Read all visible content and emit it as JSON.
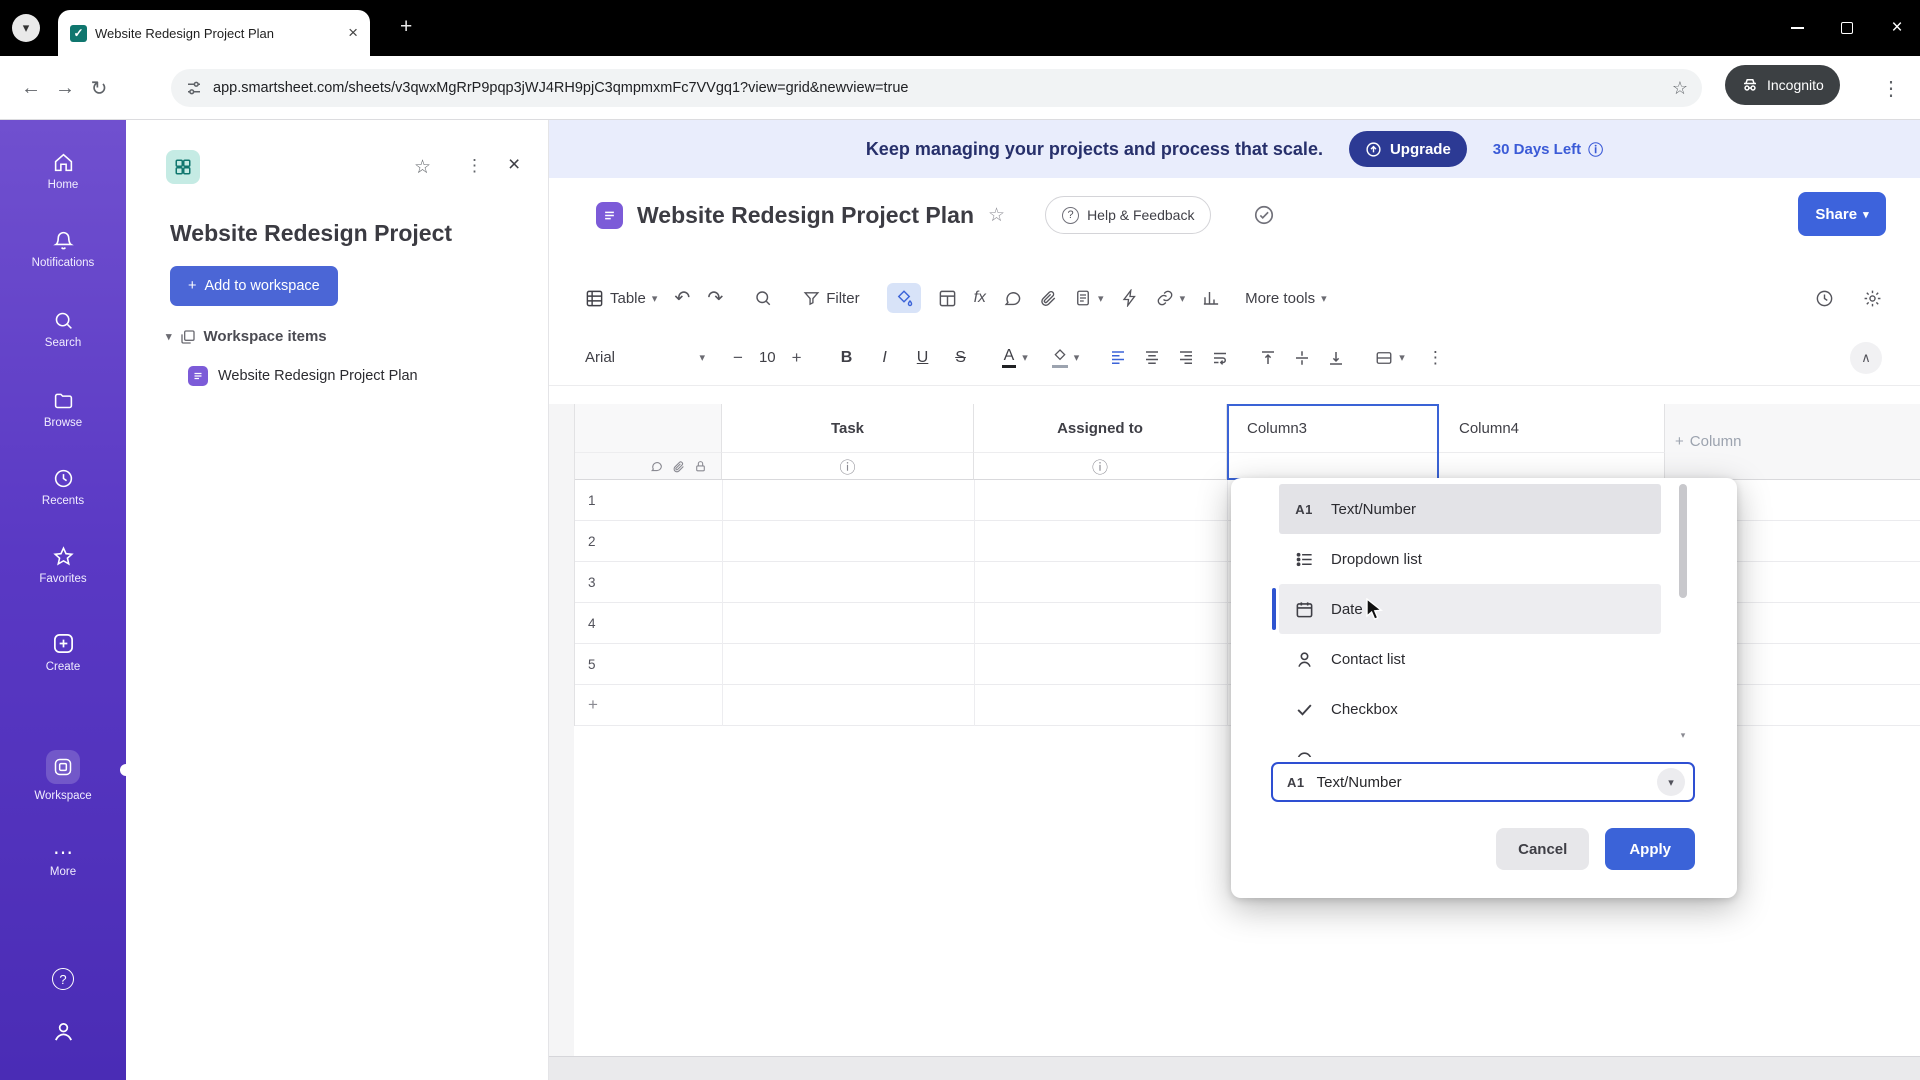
{
  "browser": {
    "tab_title": "Website Redesign Project Plan",
    "url": "app.smartsheet.com/sheets/v3qwxMgRrP9pqp3jWJ4RH9pjC3qmpmxmFc7VVgq1?view=grid&newview=true",
    "incognito_label": "Incognito"
  },
  "glyphs": {
    "chevron_down": "▾",
    "chevron_up": "∧",
    "kebab": "⋮",
    "ellipsis": "⋯",
    "star": "☆",
    "plus": "+",
    "minus": "−",
    "undo": "↶",
    "redo": "↷",
    "info": "ⓘ",
    "question": "?",
    "check": "✓",
    "close": "×",
    "back": "←",
    "forward": "→",
    "reload": "↻"
  },
  "sidebar": {
    "items": [
      {
        "label": "Home"
      },
      {
        "label": "Notifications"
      },
      {
        "label": "Search"
      },
      {
        "label": "Browse"
      },
      {
        "label": "Recents"
      },
      {
        "label": "Favorites"
      },
      {
        "label": "Create"
      },
      {
        "label": "Workspace"
      },
      {
        "label": "More"
      }
    ]
  },
  "panel": {
    "title": "Website Redesign Project",
    "add_button": "Add to workspace",
    "section_label": "Workspace items",
    "item_label": "Website Redesign Project Plan"
  },
  "banner": {
    "text": "Keep managing your projects and process that scale.",
    "upgrade_label": "Upgrade",
    "days_left": "30 Days Left"
  },
  "sheet": {
    "title": "Website Redesign Project Plan",
    "help_label": "Help & Feedback",
    "share_label": "Share"
  },
  "toolbar": {
    "table_label": "Table",
    "filter_label": "Filter",
    "more_tools_label": "More tools",
    "font_name": "Arial",
    "font_size": "10",
    "bold": "B",
    "italic": "I",
    "underline": "U",
    "strike": "S",
    "text_color": "A",
    "fx": "fx"
  },
  "grid": {
    "columns": [
      "Task",
      "Assigned to",
      "Column3",
      "Column4"
    ],
    "add_column_label": "Column",
    "rows": [
      "1",
      "2",
      "3",
      "4",
      "5"
    ]
  },
  "popup": {
    "options": [
      {
        "label": "Text/Number"
      },
      {
        "label": "Dropdown list"
      },
      {
        "label": "Date"
      },
      {
        "label": "Contact list"
      },
      {
        "label": "Checkbox"
      }
    ],
    "selected_icon": "A1",
    "selected_value": "Text/Number",
    "cancel_label": "Cancel",
    "apply_label": "Apply"
  }
}
